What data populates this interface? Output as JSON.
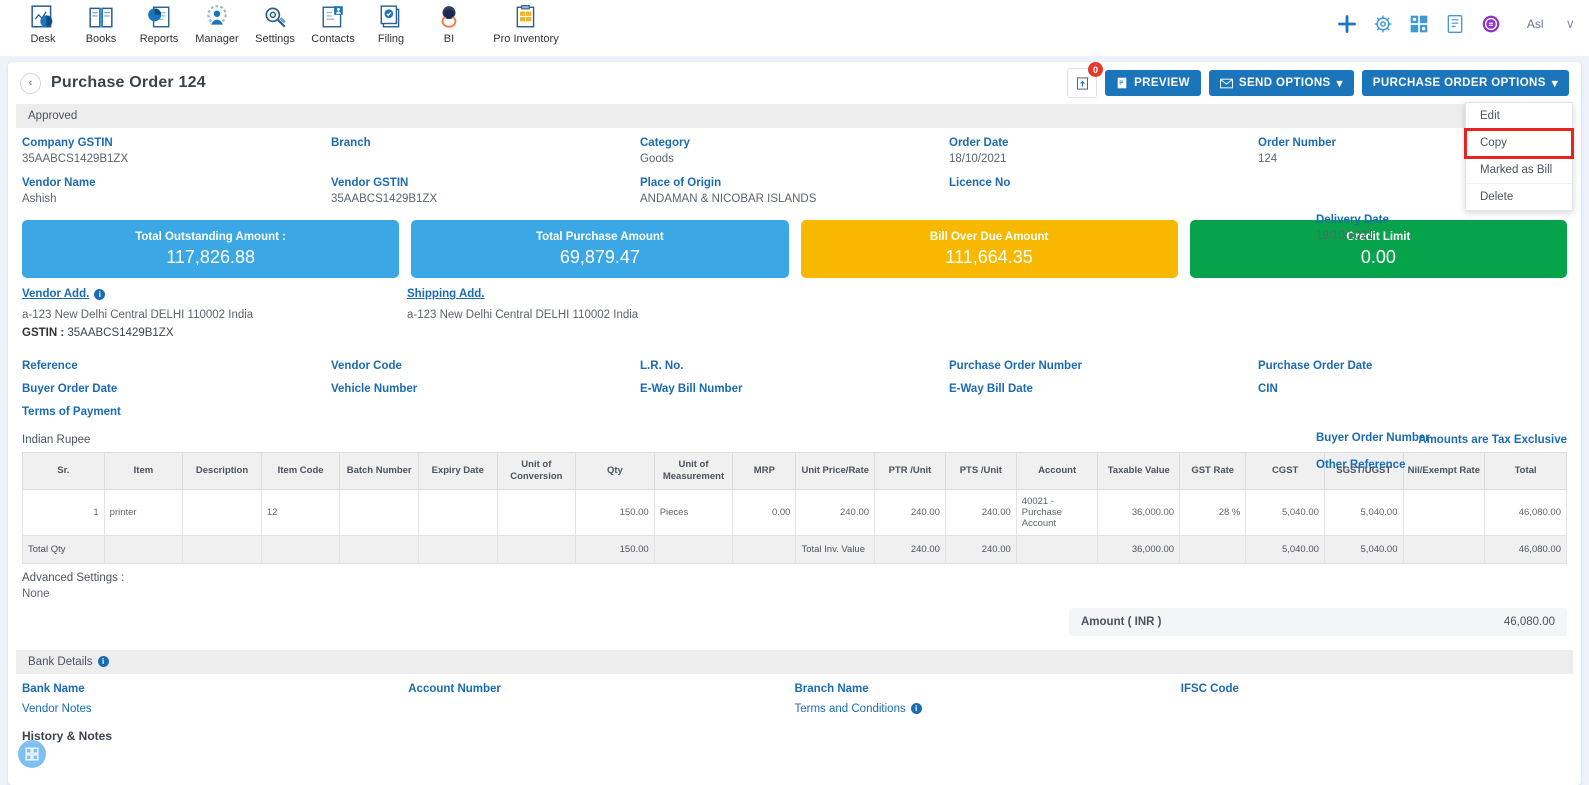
{
  "appbar": {
    "apps": [
      {
        "label": "Desk",
        "icon": "desk-icon"
      },
      {
        "label": "Books",
        "icon": "books-icon"
      },
      {
        "label": "Reports",
        "icon": "reports-icon"
      },
      {
        "label": "Manager",
        "icon": "manager-icon"
      },
      {
        "label": "Settings",
        "icon": "settings-icon"
      },
      {
        "label": "Contacts",
        "icon": "contacts-icon"
      },
      {
        "label": "Filing",
        "icon": "filing-icon"
      },
      {
        "label": "BI",
        "icon": "bi-icon"
      },
      {
        "label": "Pro Inventory",
        "icon": "pro-inventory-icon"
      }
    ],
    "tools": [
      "plus-icon",
      "gear-icon",
      "apps-grid-icon",
      "note-icon",
      "help-circle-icon"
    ],
    "user": "Asl",
    "caret": "∨"
  },
  "header": {
    "back": "‹",
    "title": "Purchase Order 124",
    "attachment_count": "0",
    "preview_label": "PREVIEW",
    "send_options_label": "SEND OPTIONS",
    "order_options_label": "PURCHASE ORDER OPTIONS",
    "caret": "▾"
  },
  "dropdown": {
    "items": [
      {
        "label": "Edit",
        "highlight": false
      },
      {
        "label": "Copy",
        "highlight": true
      },
      {
        "label": "Marked as Bill",
        "highlight": false
      },
      {
        "label": "Delete",
        "highlight": false
      }
    ]
  },
  "status": {
    "label": "Approved"
  },
  "fields_row1": [
    {
      "label": "Company GSTIN",
      "value": "35AABCS1429B1ZX"
    },
    {
      "label": "Branch",
      "value": ""
    },
    {
      "label": "Category",
      "value": "Goods"
    },
    {
      "label": "Order Date",
      "value": "18/10/2021"
    },
    {
      "label": "Order Number",
      "value": "124"
    },
    {
      "label": "Delivery Date",
      "value": "19/10/2021"
    }
  ],
  "fields_row2": [
    {
      "label": "Vendor Name",
      "value": "Ashish"
    },
    {
      "label": "Vendor GSTIN",
      "value": "35AABCS1429B1ZX"
    },
    {
      "label": "Place of Origin",
      "value": "ANDAMAN & NICOBAR ISLANDS"
    },
    {
      "label": "Licence No",
      "value": ""
    },
    {
      "label": "",
      "value": ""
    },
    {
      "label": "",
      "value": ""
    }
  ],
  "cards": [
    {
      "label": "Total Outstanding Amount :",
      "value": "117,826.88",
      "color": "#3ba7e5"
    },
    {
      "label": "Total Purchase Amount",
      "value": "69,879.47",
      "color": "#3ba7e5"
    },
    {
      "label": "Bill Over Due Amount",
      "value": "111,664.35",
      "color": "#f9b800"
    },
    {
      "label": "Credit Limit",
      "value": "0.00",
      "color": "#06a34a"
    }
  ],
  "addresses": {
    "vendor": {
      "heading": "Vendor Add.",
      "line": "a-123 New Delhi Central DELHI 110002 India",
      "gstin_label": "GSTIN :",
      "gstin_value": "35AABCS1429B1ZX"
    },
    "shipping": {
      "heading": "Shipping Add.",
      "line": "a-123 New Delhi Central DELHI 110002 India"
    }
  },
  "ref_fields_row1": [
    "Reference",
    "Vendor Code",
    "L.R. No.",
    "Purchase Order Number",
    "Purchase Order Date",
    "Buyer Order Number"
  ],
  "ref_fields_row2": [
    "Buyer Order Date",
    "Vehicle Number",
    "E-Way Bill Number",
    "E-Way Bill Date",
    "CIN",
    "Other Reference"
  ],
  "ref_fields_row3": [
    "Terms of Payment"
  ],
  "currency": {
    "label": "Indian Rupee",
    "tax_note": "Amounts are Tax Exclusive"
  },
  "table": {
    "columns": [
      "Sr.",
      "Item",
      "Description",
      "Item Code",
      "Batch Number",
      "Expiry Date",
      "Unit of Conversion",
      "Qty",
      "Unit of Measurement",
      "MRP",
      "Unit Price/Rate",
      "PTR /Unit",
      "PTS /Unit",
      "Account",
      "Taxable Value",
      "GST Rate",
      "CGST",
      "SGST/UGST",
      "Nil/Exempt Rate",
      "Total"
    ],
    "rows": [
      {
        "sr": "1",
        "item": "printer",
        "description": "",
        "item_code": "12",
        "batch_number": "",
        "expiry_date": "",
        "unit_of_conversion": "",
        "qty": "150.00",
        "unit_of_measurement": "Pieces",
        "mrp": "0.00",
        "unit_price": "240.00",
        "ptr_unit": "240.00",
        "pts_unit": "240.00",
        "account": "40021 - Purchase Account",
        "taxable_value": "36,000.00",
        "gst_rate": "28 %",
        "cgst": "5,040.00",
        "sgst": "5,040.00",
        "nil_exempt": "",
        "total": "46,080.00"
      }
    ],
    "totals": {
      "label": "Total Qty",
      "qty": "150.00",
      "inv_label": "Total Inv. Value",
      "unit_price": "240.00",
      "ptr_unit": "240.00",
      "pts_unit": "",
      "taxable_value": "36,000.00",
      "gst_rate": "",
      "cgst": "5,040.00",
      "sgst": "5,040.00",
      "nil_exempt": "",
      "total": "46,080.00"
    }
  },
  "advanced": {
    "label": "Advanced Settings :",
    "value": "None"
  },
  "amount": {
    "label": "Amount ( INR )",
    "value": "46,080.00"
  },
  "bank": {
    "heading": "Bank Details",
    "fields": [
      "Bank Name",
      "Account Number",
      "Branch Name",
      "IFSC Code"
    ]
  },
  "notes": {
    "vendor_notes": "Vendor Notes",
    "terms": "Terms and Conditions"
  },
  "history": {
    "label": "History & Notes"
  }
}
